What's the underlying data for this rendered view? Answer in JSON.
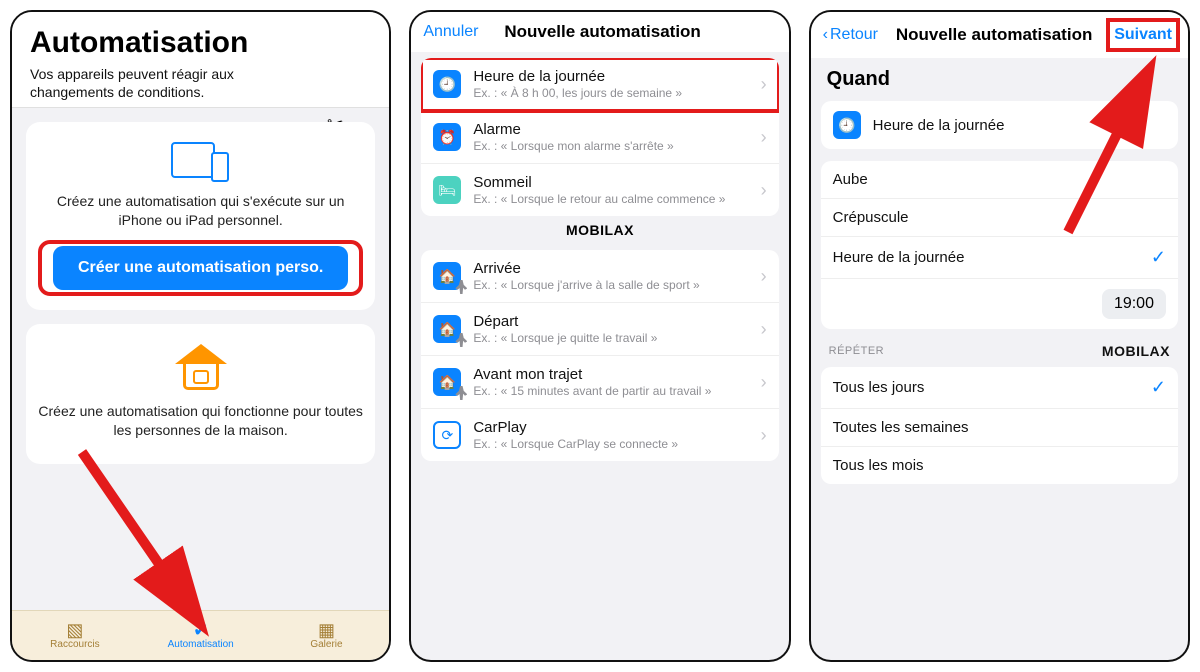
{
  "brand": "MOBILAX",
  "screen1": {
    "title": "Automatisation",
    "subtitle": "Vos appareils peuvent réagir aux changements de conditions.",
    "card1_desc": "Créez une automatisation qui s'exécute sur un iPhone ou iPad personnel.",
    "create_btn": "Créer une automatisation perso.",
    "card2_desc": "Créez une automatisation qui fonctionne pour toutes les personnes de la maison.",
    "tabs": {
      "shortcuts": "Raccourcis",
      "automation": "Automatisation",
      "gallery": "Galerie"
    }
  },
  "screen2": {
    "nav_cancel": "Annuler",
    "nav_title": "Nouvelle automatisation",
    "rows": [
      {
        "title": "Heure de la journée",
        "sub": "Ex. : « À 8 h 00, les jours de semaine »"
      },
      {
        "title": "Alarme",
        "sub": "Ex. : « Lorsque mon alarme s'arrête »"
      },
      {
        "title": "Sommeil",
        "sub": "Ex. : « Lorsque le retour au calme commence »"
      },
      {
        "title": "Arrivée",
        "sub": "Ex. : « Lorsque j'arrive à la salle de sport »"
      },
      {
        "title": "Départ",
        "sub": "Ex. : « Lorsque je quitte le travail »"
      },
      {
        "title": "Avant mon trajet",
        "sub": "Ex. : « 15 minutes avant de partir au travail »"
      },
      {
        "title": "CarPlay",
        "sub": "Ex. : « Lorsque CarPlay se connecte »"
      }
    ]
  },
  "screen3": {
    "nav_back": "Retour",
    "nav_title": "Nouvelle automatisation",
    "nav_next": "Suivant",
    "when": "Quand",
    "when_row": "Heure de la journée",
    "opts": [
      "Aube",
      "Crépuscule",
      "Heure de la journée"
    ],
    "time": "19:00",
    "repeat_label": "RÉPÉTER",
    "repeat": [
      "Tous les jours",
      "Toutes les semaines",
      "Tous les mois"
    ]
  }
}
